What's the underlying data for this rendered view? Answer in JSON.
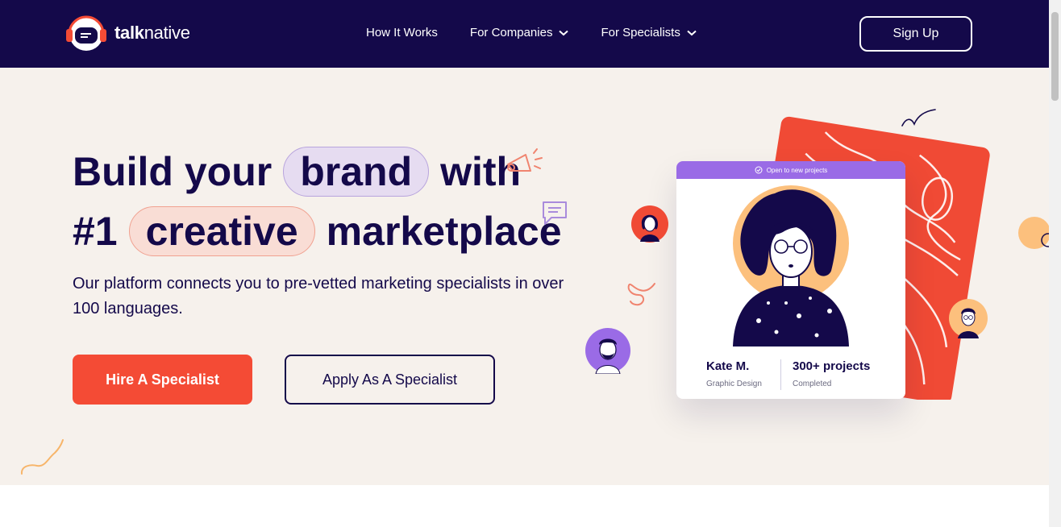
{
  "header": {
    "logo": {
      "bold": "talk",
      "light": "native"
    },
    "nav": [
      {
        "label": "How It Works"
      },
      {
        "label": "For Companies"
      },
      {
        "label": "For Specialists"
      }
    ],
    "signup_label": "Sign Up"
  },
  "hero": {
    "line1": {
      "before": "Build your",
      "pill": "brand",
      "after": "with"
    },
    "line2": {
      "before": "#1",
      "pill": "creative",
      "after": "marketplace"
    },
    "subtitle": "Our platform connects you to pre-vetted marketing specialists in over 100 languages.",
    "hire_label": "Hire A Specialist",
    "apply_label": "Apply As A Specialist"
  },
  "profile_card": {
    "badge": "Open to new projects",
    "name": "Kate M.",
    "role": "Graphic Design",
    "projects": "300+ projects",
    "projects_caption": "Completed"
  },
  "colors": {
    "navy": "#14094a",
    "coral": "#f44b35",
    "cream": "#f6f1ec",
    "lavender": "#e6dcf1",
    "purple": "#9a6be6",
    "peach": "#fcc07d"
  }
}
